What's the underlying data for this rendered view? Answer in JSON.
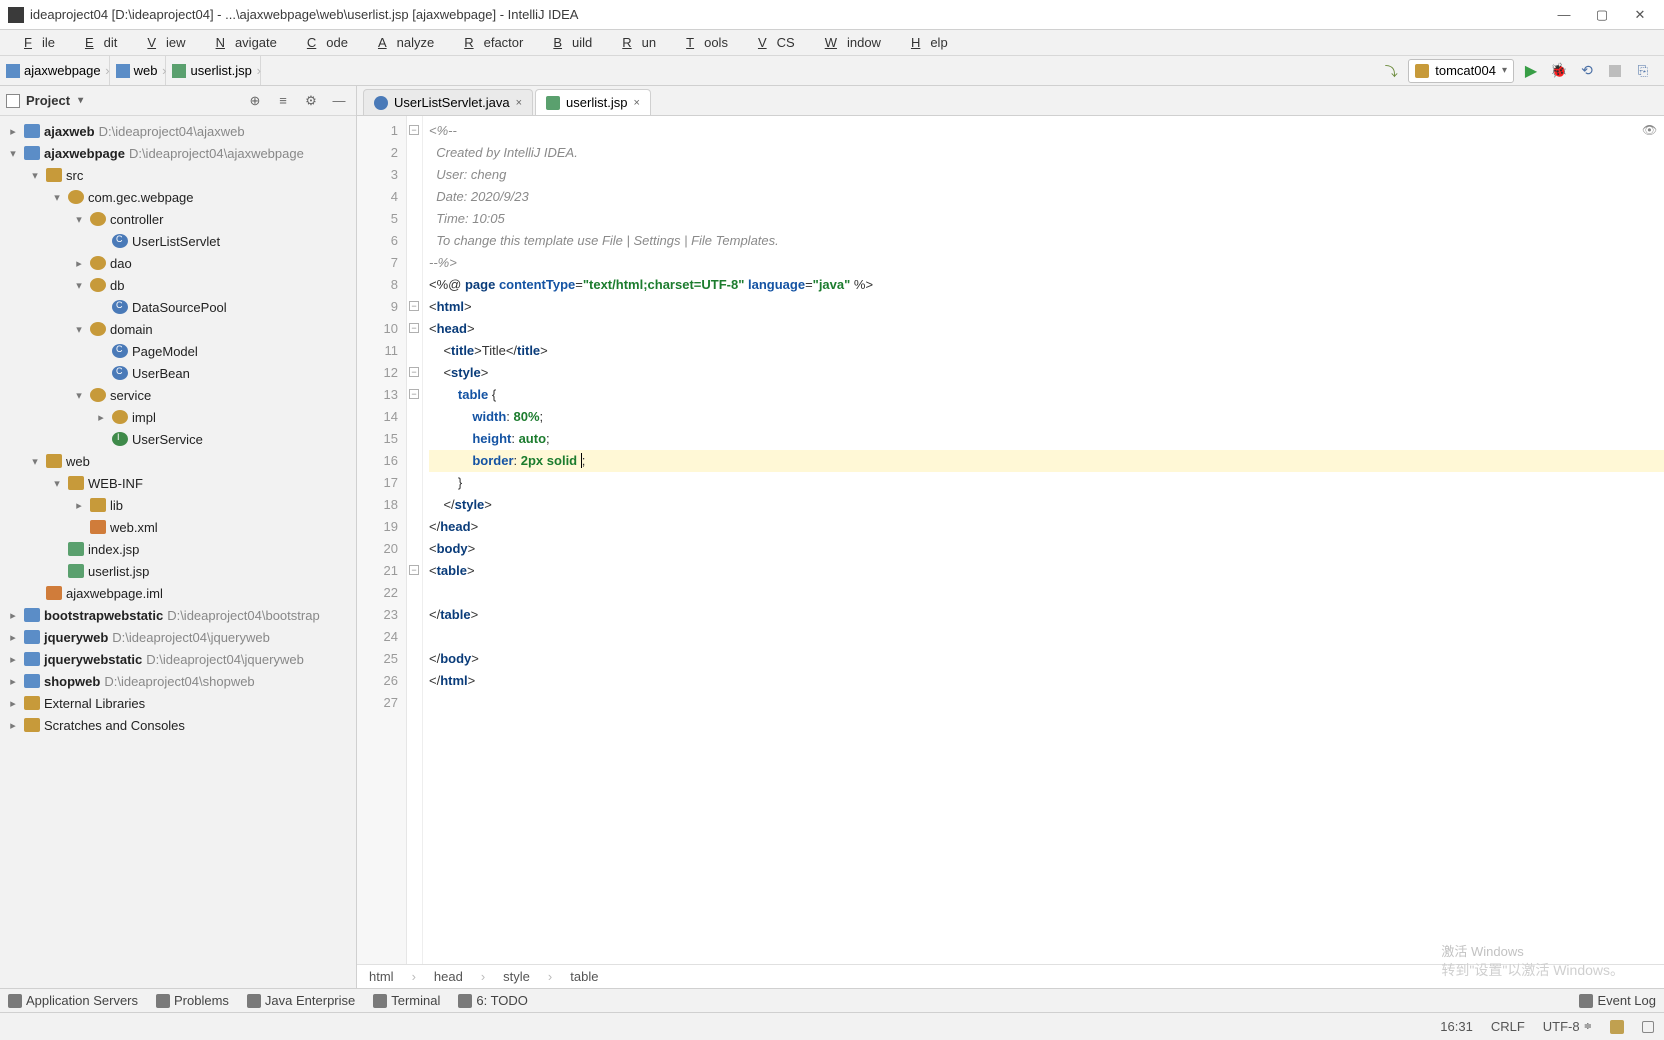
{
  "window": {
    "title": "ideaproject04 [D:\\ideaproject04] - ...\\ajaxwebpage\\web\\userlist.jsp [ajaxwebpage] - IntelliJ IDEA"
  },
  "menu": [
    "File",
    "Edit",
    "View",
    "Navigate",
    "Code",
    "Analyze",
    "Refactor",
    "Build",
    "Run",
    "Tools",
    "VCS",
    "Window",
    "Help"
  ],
  "breadcrumb": {
    "items": [
      {
        "label": "ajaxwebpage",
        "type": "module"
      },
      {
        "label": "web",
        "type": "folder"
      },
      {
        "label": "userlist.jsp",
        "type": "file"
      }
    ]
  },
  "run_config": {
    "name": "tomcat004"
  },
  "project": {
    "title": "Project",
    "tree": [
      {
        "d": 0,
        "tw": "▸",
        "ico": "module",
        "bold": "ajaxweb",
        "path": "D:\\ideaproject04\\ajaxweb"
      },
      {
        "d": 0,
        "tw": "▾",
        "ico": "module",
        "bold": "ajaxwebpage",
        "path": "D:\\ideaproject04\\ajaxwebpage"
      },
      {
        "d": 1,
        "tw": "▾",
        "ico": "folder",
        "label": "src"
      },
      {
        "d": 2,
        "tw": "▾",
        "ico": "pkg",
        "label": "com.gec.webpage"
      },
      {
        "d": 3,
        "tw": "▾",
        "ico": "pkg",
        "label": "controller"
      },
      {
        "d": 4,
        "tw": "",
        "ico": "class",
        "label": "UserListServlet"
      },
      {
        "d": 3,
        "tw": "▸",
        "ico": "pkg",
        "label": "dao"
      },
      {
        "d": 3,
        "tw": "▾",
        "ico": "pkg",
        "label": "db"
      },
      {
        "d": 4,
        "tw": "",
        "ico": "class",
        "label": "DataSourcePool"
      },
      {
        "d": 3,
        "tw": "▾",
        "ico": "pkg",
        "label": "domain"
      },
      {
        "d": 4,
        "tw": "",
        "ico": "class",
        "label": "PageModel"
      },
      {
        "d": 4,
        "tw": "",
        "ico": "class",
        "label": "UserBean"
      },
      {
        "d": 3,
        "tw": "▾",
        "ico": "pkg",
        "label": "service"
      },
      {
        "d": 4,
        "tw": "▸",
        "ico": "pkg",
        "label": "impl"
      },
      {
        "d": 4,
        "tw": "",
        "ico": "iface",
        "label": "UserService"
      },
      {
        "d": 1,
        "tw": "▾",
        "ico": "folder",
        "label": "web"
      },
      {
        "d": 2,
        "tw": "▾",
        "ico": "folder",
        "label": "WEB-INF"
      },
      {
        "d": 3,
        "tw": "▸",
        "ico": "folder",
        "label": "lib"
      },
      {
        "d": 3,
        "tw": "",
        "ico": "xml",
        "label": "web.xml"
      },
      {
        "d": 2,
        "tw": "",
        "ico": "jsp",
        "label": "index.jsp"
      },
      {
        "d": 2,
        "tw": "",
        "ico": "jsp",
        "label": "userlist.jsp"
      },
      {
        "d": 1,
        "tw": "",
        "ico": "xml",
        "label": "ajaxwebpage.iml"
      },
      {
        "d": 0,
        "tw": "▸",
        "ico": "module",
        "bold": "bootstrapwebstatic",
        "path": "D:\\ideaproject04\\bootstrap"
      },
      {
        "d": 0,
        "tw": "▸",
        "ico": "module",
        "bold": "jqueryweb",
        "path": "D:\\ideaproject04\\jqueryweb"
      },
      {
        "d": 0,
        "tw": "▸",
        "ico": "module",
        "bold": "jquerywebstatic",
        "path": "D:\\ideaproject04\\jqueryweb"
      },
      {
        "d": 0,
        "tw": "▸",
        "ico": "module",
        "bold": "shopweb",
        "path": "D:\\ideaproject04\\shopweb"
      },
      {
        "d": 0,
        "tw": "▸",
        "ico": "ext",
        "label": "External Libraries"
      },
      {
        "d": 0,
        "tw": "▸",
        "ico": "scratch",
        "label": "Scratches and Consoles"
      }
    ]
  },
  "tabs": [
    {
      "label": "UserListServlet.java",
      "ico": "cls",
      "active": false
    },
    {
      "label": "userlist.jsp",
      "ico": "jsp",
      "active": true
    }
  ],
  "code": {
    "active_line": 16,
    "lines": [
      {
        "n": 1,
        "html": "<span class='cmt'>&lt;%--</span>"
      },
      {
        "n": 2,
        "html": "<span class='cmt'>  Created by IntelliJ IDEA.</span>"
      },
      {
        "n": 3,
        "html": "<span class='cmt'>  User: cheng</span>"
      },
      {
        "n": 4,
        "html": "<span class='cmt'>  Date: 2020/9/23</span>"
      },
      {
        "n": 5,
        "html": "<span class='cmt'>  Time: 10:05</span>"
      },
      {
        "n": 6,
        "html": "<span class='cmt'>  To change this template use File | Settings | File Templates.</span>"
      },
      {
        "n": 7,
        "html": "<span class='cmt'>--%&gt;</span>"
      },
      {
        "n": 8,
        "html": "&lt;%@ <span class='kw'>page</span> <span class='attr'>contentType</span>=<span class='str'>\"text/html;charset=UTF-8\"</span> <span class='attr'>language</span>=<span class='str'>\"java\"</span> %&gt;"
      },
      {
        "n": 9,
        "html": "&lt;<span class='tag'>html</span>&gt;"
      },
      {
        "n": 10,
        "html": "&lt;<span class='tag'>head</span>&gt;"
      },
      {
        "n": 11,
        "html": "    &lt;<span class='tag'>title</span>&gt;Title&lt;/<span class='tag'>title</span>&gt;"
      },
      {
        "n": 12,
        "html": "    &lt;<span class='tag'>style</span>&gt;"
      },
      {
        "n": 13,
        "html": "        <span class='sel'>table</span> {"
      },
      {
        "n": 14,
        "html": "            <span class='prop'>width</span>: <span class='val'>80%</span>;"
      },
      {
        "n": 15,
        "html": "            <span class='prop'>height</span>: <span class='val'>auto</span>;"
      },
      {
        "n": 16,
        "html": "            <span class='prop'>border</span>: <span class='val'>2px</span> <span class='val'>solid</span> <span class='cursor'></span>;"
      },
      {
        "n": 17,
        "html": "        }"
      },
      {
        "n": 18,
        "html": "    &lt;/<span class='tag'>style</span>&gt;"
      },
      {
        "n": 19,
        "html": "&lt;/<span class='tag'>head</span>&gt;"
      },
      {
        "n": 20,
        "html": "&lt;<span class='tag'>body</span>&gt;"
      },
      {
        "n": 21,
        "html": "&lt;<span class='tag'>table</span>&gt;"
      },
      {
        "n": 22,
        "html": ""
      },
      {
        "n": 23,
        "html": "&lt;/<span class='tag'>table</span>&gt;"
      },
      {
        "n": 24,
        "html": ""
      },
      {
        "n": 25,
        "html": "&lt;/<span class='tag'>body</span>&gt;"
      },
      {
        "n": 26,
        "html": "&lt;/<span class='tag'>html</span>&gt;"
      },
      {
        "n": 27,
        "html": ""
      }
    ]
  },
  "editor_breadcrumb": [
    "html",
    "head",
    "style",
    "table"
  ],
  "bottom_tools": [
    {
      "label": "Application Servers"
    },
    {
      "label": "Problems"
    },
    {
      "label": "Java Enterprise"
    },
    {
      "label": "Terminal"
    },
    {
      "label": "6: TODO"
    }
  ],
  "event_log": "Event Log",
  "status": {
    "time": "16:31",
    "crlf": "CRLF",
    "enc": "UTF-8",
    "insp": "⎘"
  },
  "watermark": {
    "l1": "激活 Windows",
    "l2": "转到\"设置\"以激活 Windows。"
  }
}
